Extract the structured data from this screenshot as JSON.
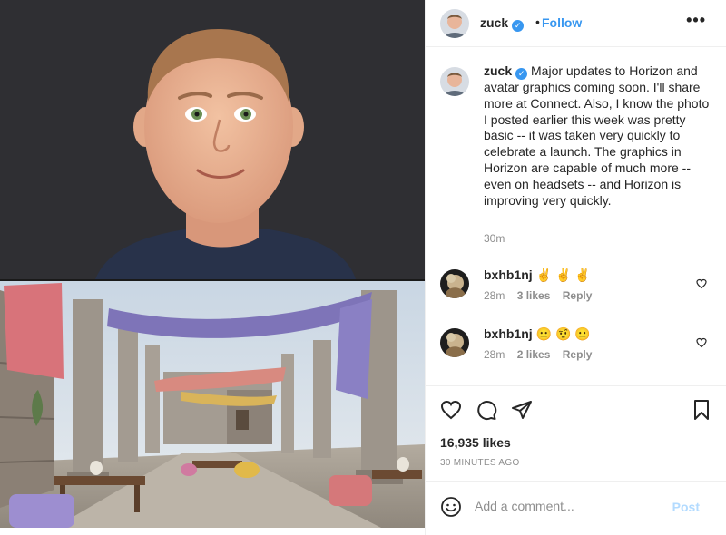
{
  "header": {
    "username": "zuck",
    "separator": "•",
    "follow_label": "Follow",
    "more_label": "•••"
  },
  "caption": {
    "username": "zuck",
    "text": "Major updates to Horizon and avatar graphics coming soon. I'll share more at Connect. Also, I know the photo I posted earlier this week was pretty basic -- it was taken very quickly to celebrate a launch. The graphics in Horizon are capable of much more -- even on headsets -- and Horizon is improving very quickly.",
    "time": "30m"
  },
  "comments": [
    {
      "username": "bxhb1nj",
      "emoji": "✌ ✌ ✌",
      "time": "28m",
      "likes": "3 likes",
      "reply": "Reply"
    },
    {
      "username": "bxhb1nj",
      "emoji": "😐 🤨 😐",
      "time": "28m",
      "likes": "2 likes",
      "reply": "Reply"
    }
  ],
  "likes": "16,935 likes",
  "post_date": "30 MINUTES AGO",
  "add_comment": {
    "placeholder": "Add a comment...",
    "post_label": "Post"
  },
  "colors": {
    "link_blue": "#3897f0",
    "post_disabled": "#b3dbff",
    "meta_gray": "#8e8e8e"
  },
  "icons": [
    "verified-badge-icon",
    "more-icon",
    "heart-icon",
    "comment-icon",
    "share-icon",
    "bookmark-icon",
    "smiley-icon"
  ]
}
